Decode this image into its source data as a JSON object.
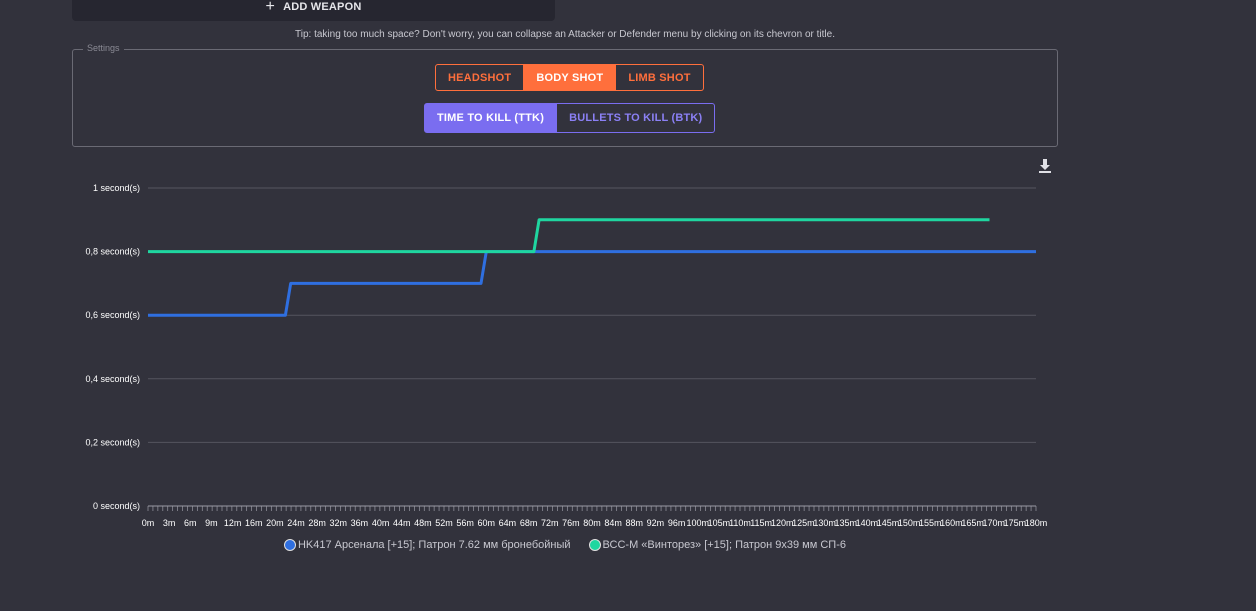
{
  "add_weapon": {
    "label": "ADD WEAPON",
    "icon": "plus-icon"
  },
  "tip": "Tip: taking too much space? Don't worry, you can collapse an Attacker or Defender menu by clicking on its chevron or title.",
  "settings": {
    "legend": "Settings",
    "shot_buttons": [
      {
        "label": "HEADSHOT",
        "active": false
      },
      {
        "label": "BODY SHOT",
        "active": true
      },
      {
        "label": "LIMB SHOT",
        "active": false
      }
    ],
    "mode_buttons": [
      {
        "label": "TIME TO KILL (TTK)",
        "active": true
      },
      {
        "label": "BULLETS TO KILL (BTK)",
        "active": false
      }
    ]
  },
  "download_icon": "download-icon",
  "colors": {
    "accent_orange": "#ff6f3c",
    "accent_purple": "#7a6df0",
    "series1": "#2f6fe0",
    "series2": "#1fd6a0"
  },
  "chart_data": {
    "type": "line",
    "x": [
      "0m",
      "3m",
      "6m",
      "9m",
      "12m",
      "16m",
      "20m",
      "24m",
      "28m",
      "32m",
      "36m",
      "40m",
      "44m",
      "48m",
      "52m",
      "56m",
      "60m",
      "64m",
      "68m",
      "72m",
      "76m",
      "80m",
      "84m",
      "88m",
      "92m",
      "96m",
      "100m",
      "105m",
      "110m",
      "115m",
      "120m",
      "125m",
      "130m",
      "135m",
      "140m",
      "145m",
      "150m",
      "155m",
      "160m",
      "165m",
      "170m",
      "175m",
      "180m"
    ],
    "y_ticks": [
      "0 second(s)",
      "0,2 second(s)",
      "0,4 second(s)",
      "0,6 second(s)",
      "0,8 second(s)",
      "1 second(s)"
    ],
    "y_tick_values": [
      0,
      0.2,
      0.4,
      0.6,
      0.8,
      1
    ],
    "ylim": [
      0,
      1
    ],
    "grid": true,
    "legend_position": "bottom",
    "series": [
      {
        "name": "HK417 Арсенала [+15]; Патрон 7.62 мм бронебойный",
        "color": "#2f6fe0",
        "points": [
          [
            0,
            0.6
          ],
          [
            22,
            0.6
          ],
          [
            23,
            0.7
          ],
          [
            59,
            0.7
          ],
          [
            60,
            0.8
          ],
          [
            180,
            0.8
          ]
        ]
      },
      {
        "name": "ВСС-М «Винторез» [+15]; Патрон 9x39 мм СП-6",
        "color": "#1fd6a0",
        "points": [
          [
            0,
            0.8
          ],
          [
            69,
            0.8
          ],
          [
            70,
            0.9
          ],
          [
            169,
            0.9
          ]
        ]
      }
    ]
  }
}
